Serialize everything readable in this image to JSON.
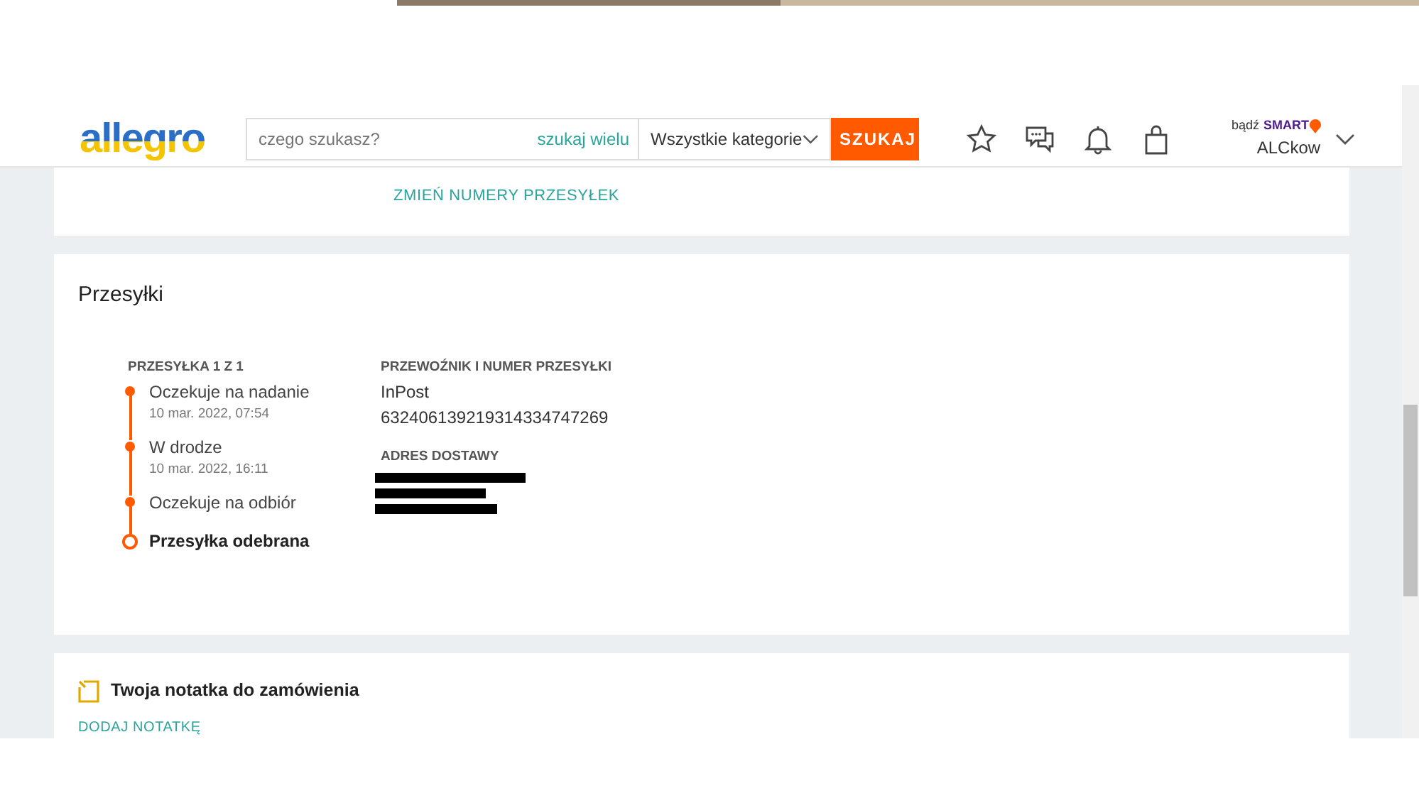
{
  "header": {
    "logo": "allegro",
    "search": {
      "placeholder": "czego szukasz?",
      "multi_link": "szukaj wielu",
      "category": "Wszystkie kategorie",
      "button": "SZUKAJ"
    },
    "smart_prefix": "bądź",
    "smart_label": "SMART",
    "user": "ALCkow"
  },
  "top_card": {
    "link": "ZMIEŃ NUMERY PRZESYŁEK"
  },
  "shipments": {
    "title": "Przesyłki",
    "counter": "PRZESYŁKA 1 Z 1",
    "steps": [
      {
        "label": "Oczekuje na nadanie",
        "time": "10 mar. 2022, 07:54",
        "current": false
      },
      {
        "label": "W drodze",
        "time": "10 mar. 2022, 16:11",
        "current": false
      },
      {
        "label": "Oczekuje na odbiór",
        "current": false
      },
      {
        "label": "Przesyłka odebrana",
        "current": true
      }
    ],
    "carrier_heading": "PRZEWOŹNIK I NUMER PRZESYŁKI",
    "carrier": "InPost",
    "tracking_number": "632406139219314334747269",
    "address_heading": "ADRES DOSTAWY"
  },
  "note": {
    "title": "Twoja notatka do zamówienia",
    "link": "DODAJ NOTATKĘ"
  }
}
